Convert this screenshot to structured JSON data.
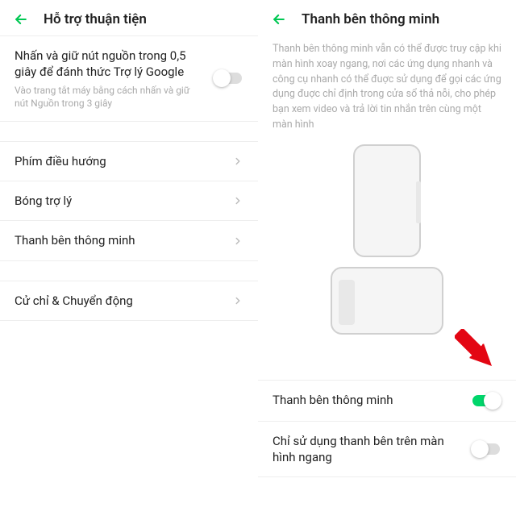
{
  "left": {
    "title": "Hỗ trợ thuận tiện",
    "assistant_row": {
      "label": "Nhấn và giữ nút nguồn trong 0,5 giây để đánh thức Trợ lý Google",
      "sub": "Vào trang tắt máy bằng cách nhấn và giữ nút Nguồn trong 3 giây"
    },
    "nav_keys": "Phím điều hướng",
    "assistive_ball": "Bóng trợ lý",
    "smart_sidebar": "Thanh bên thông minh",
    "gesture_motion": "Cử chỉ & Chuyển động"
  },
  "right": {
    "title": "Thanh bên thông minh",
    "desc": "Thanh bên thông minh vẫn có thể được truy cập khi màn hình xoay ngang, nơi các ứng dụng nhanh và công cụ nhanh có thể đuợc sử dụng để gọi các ứng dụng đuợc chỉ định trong cửa sổ thả nỗi, cho phép bạn xem video và trả lời tin nhắn trên cùng một màn hình",
    "smart_sidebar_toggle": "Thanh bên thông minh",
    "landscape_only": "Chỉ sử dụng thanh bên trên màn hình ngang"
  }
}
